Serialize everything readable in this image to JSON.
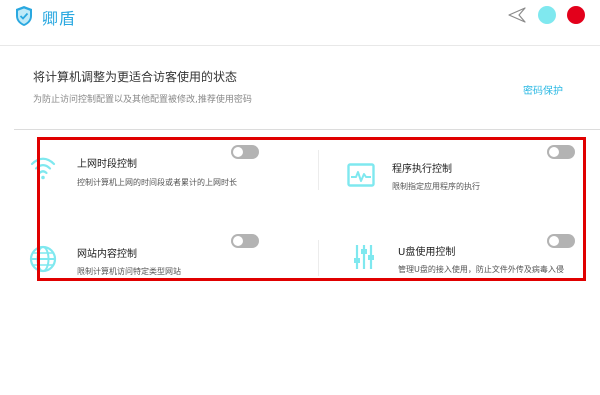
{
  "app": {
    "title": "卿盾"
  },
  "hint": {
    "title": "将计算机调整为更适合访客使用的状态",
    "subtitle": "为防止访问控制配置以及其他配置被修改,推荐使用密码",
    "password_link": "密码保护"
  },
  "features": [
    {
      "title": "上网时段控制",
      "desc": "控制计算机上网的时间段或者累计的上网时长",
      "icon": "wifi-icon",
      "enabled": false
    },
    {
      "title": "程序执行控制",
      "desc": "限制指定应用程序的执行",
      "icon": "monitor-icon",
      "enabled": false
    },
    {
      "title": "网站内容控制",
      "desc": "限制计算机访问特定类型网站",
      "icon": "globe-icon",
      "enabled": false
    },
    {
      "title": "U盘使用控制",
      "desc": "管理U盘的接入使用，防止文件外传及病毒入侵",
      "icon": "sliders-icon",
      "enabled": false
    }
  ],
  "colors": {
    "accent": "#2aa8e0",
    "icon": "#7fe8ef",
    "close": "#e3001b",
    "highlight_border": "#e00000",
    "toggle_off": "#b3b3b3"
  }
}
